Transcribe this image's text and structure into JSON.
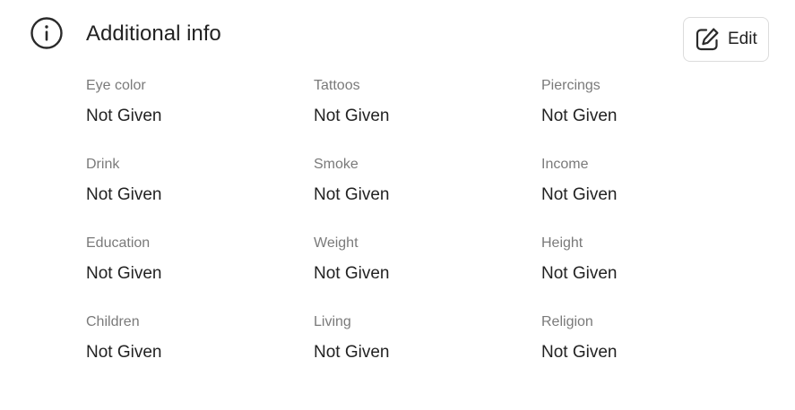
{
  "header": {
    "title": "Additional info",
    "icon": "info-icon",
    "edit_label": "Edit",
    "edit_icon": "edit-pencil-icon"
  },
  "fields": [
    {
      "label": "Eye color",
      "value": "Not Given"
    },
    {
      "label": "Tattoos",
      "value": "Not Given"
    },
    {
      "label": "Piercings",
      "value": "Not Given"
    },
    {
      "label": "Drink",
      "value": "Not Given"
    },
    {
      "label": "Smoke",
      "value": "Not Given"
    },
    {
      "label": "Income",
      "value": "Not Given"
    },
    {
      "label": "Education",
      "value": "Not Given"
    },
    {
      "label": "Weight",
      "value": "Not Given"
    },
    {
      "label": "Height",
      "value": "Not Given"
    },
    {
      "label": "Children",
      "value": "Not Given"
    },
    {
      "label": "Living",
      "value": "Not Given"
    },
    {
      "label": "Religion",
      "value": "Not Given"
    }
  ],
  "colors": {
    "text": "#222222",
    "label": "#7a7a7a",
    "border": "#dcdcdc"
  }
}
